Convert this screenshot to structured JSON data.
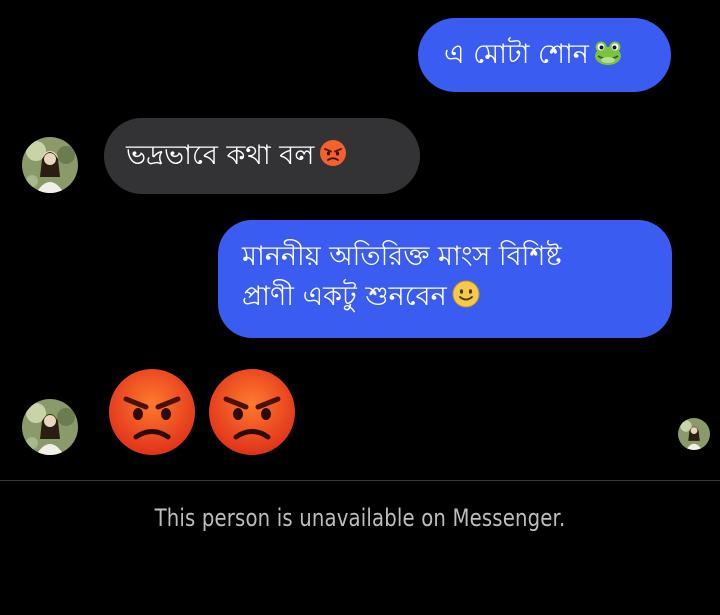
{
  "conversation": {
    "messages": [
      {
        "sender": "me",
        "text": "এ মোটা শোন",
        "emoji": "frog-face-icon"
      },
      {
        "sender": "contact",
        "text": "ভদ্রভাবে কথা বল",
        "emoji": "angry-face-icon"
      },
      {
        "sender": "me",
        "lines": [
          "মাননীয় অতিরিক্ত মাংস বিশিষ্ট",
          "প্রাণী একটু শুনবেন"
        ],
        "emoji": "slightly-smiling-face-icon"
      },
      {
        "sender": "contact",
        "emojis": [
          "pouting-face-icon",
          "pouting-face-icon"
        ]
      }
    ]
  },
  "footer": {
    "status": "This person is unavailable on Messenger."
  },
  "colors": {
    "background": "#000000",
    "sent_bubble": "#3a5cf0",
    "received_bubble": "#333336",
    "footer_text": "#bdbdbd",
    "divider": "#3a3a3a"
  }
}
